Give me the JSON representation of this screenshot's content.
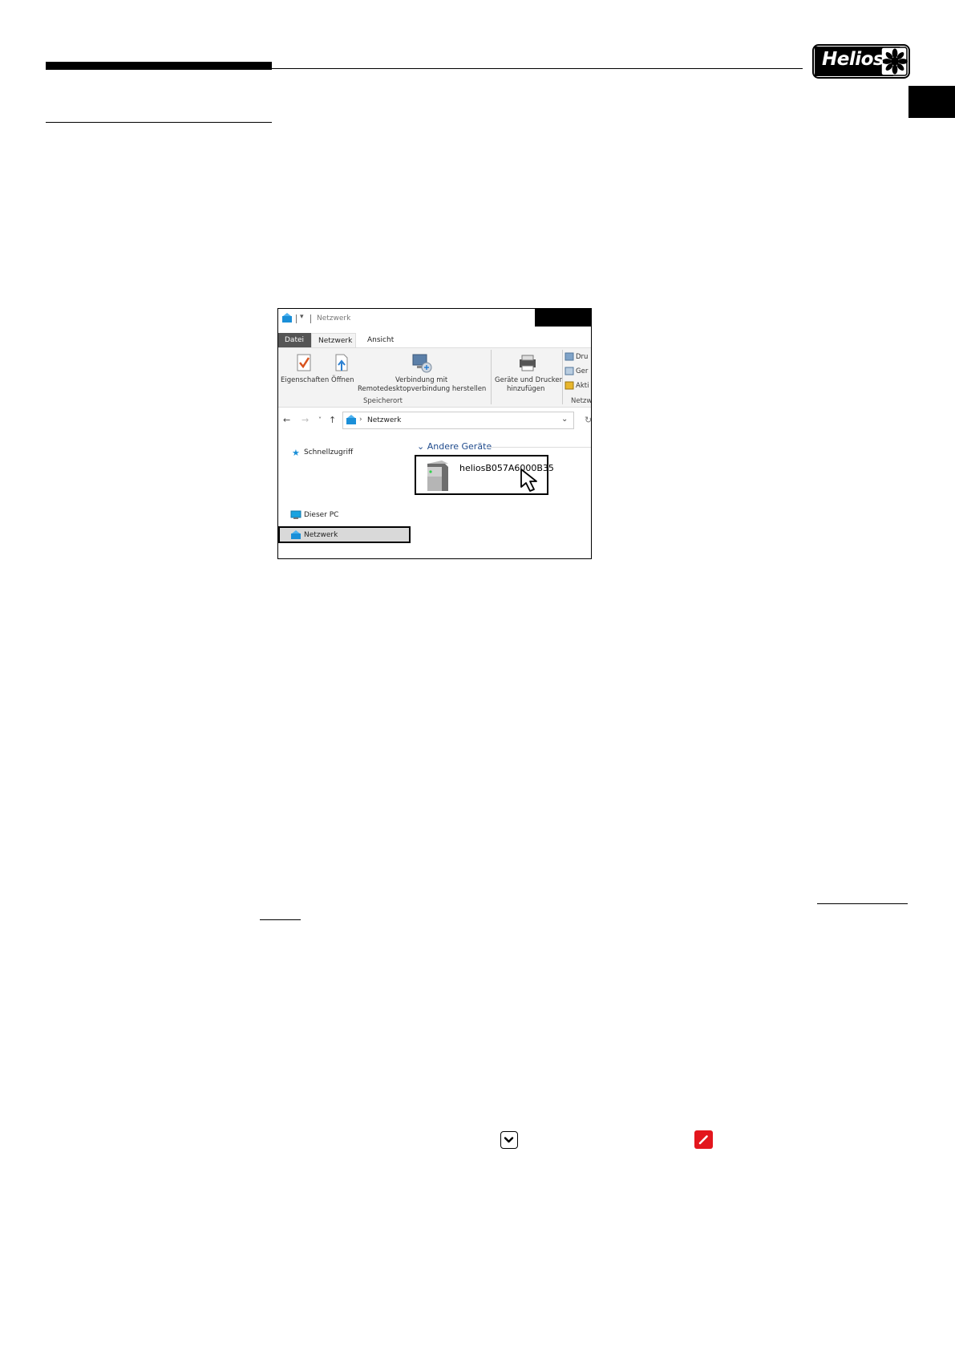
{
  "brand": {
    "logo_text": "Helios"
  },
  "explorer": {
    "window_title": "Netzwerk",
    "tabs": [
      "Datei",
      "Netzwerk",
      "Ansicht"
    ],
    "ribbon": {
      "btn_properties": "Eigenschaften",
      "btn_open": "Öffnen",
      "btn_remote_1": "Verbindung mit",
      "btn_remote_2": "Remotedesktopverbindung herstellen",
      "group_location": "Speicherort",
      "btn_devices_1": "Geräte und Drucker",
      "btn_devices_2": "hinzufügen",
      "side_item_1": "Dru",
      "side_item_2": "Ger",
      "side_item_3": "Akti",
      "group_network": "Netzw"
    },
    "address": "Netzwerk",
    "sidebar": {
      "quick_access": "Schnellzugriff",
      "this_pc": "Dieser PC",
      "network": "Netzwerk"
    },
    "group_header": "Andere Geräte",
    "device_name": "heliosB057A6000B35"
  },
  "colors": {
    "accent_red": "#e3161d",
    "explorer_blue": "#1e4a8c"
  },
  "icons": {
    "chevron": "chevron-down-icon",
    "edit": "pencil-icon"
  }
}
